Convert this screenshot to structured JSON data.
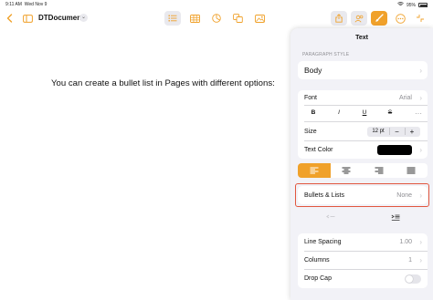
{
  "status_bar": {
    "time": "9:11 AM",
    "date": "Wed Nov 9",
    "battery": "95%"
  },
  "toolbar": {
    "document_name": "DTDocument",
    "title_menu_glyph": "⌄",
    "back_icon": "chevron-left-icon",
    "sidebar_icon": "sidebar-icon",
    "list_icon": "list-icon",
    "table_icon": "table-icon",
    "chart_icon": "chart-icon",
    "shape_icon": "shape-icon",
    "media_icon": "media-icon",
    "share_icon": "share-icon",
    "collab_icon": "collaborate-icon",
    "format_icon": "paintbrush-icon",
    "more_icon": "more-icon",
    "accent_color": "#f0a12a"
  },
  "document": {
    "body_text": "You can create a bullet list in Pages with different options:"
  },
  "format_panel": {
    "title": "Text",
    "paragraph_style_label": "PARAGRAPH STYLE",
    "paragraph_style_value": "Body",
    "font_label": "Font",
    "font_value": "Arial",
    "style_buttons": [
      "B",
      "I",
      "U",
      "S"
    ],
    "size_label": "Size",
    "size_value": "12 pt",
    "size_minus": "−",
    "size_plus": "+",
    "text_color_label": "Text Color",
    "text_color_value": "#000000",
    "alignment_selected": "left",
    "bullets_label": "Bullets & Lists",
    "bullets_value": "None",
    "line_spacing_label": "Line Spacing",
    "line_spacing_value": "1.00",
    "columns_label": "Columns",
    "columns_value": "1",
    "drop_cap_label": "Drop Cap",
    "drop_cap_on": false,
    "highlight_color": "#e2573f"
  }
}
